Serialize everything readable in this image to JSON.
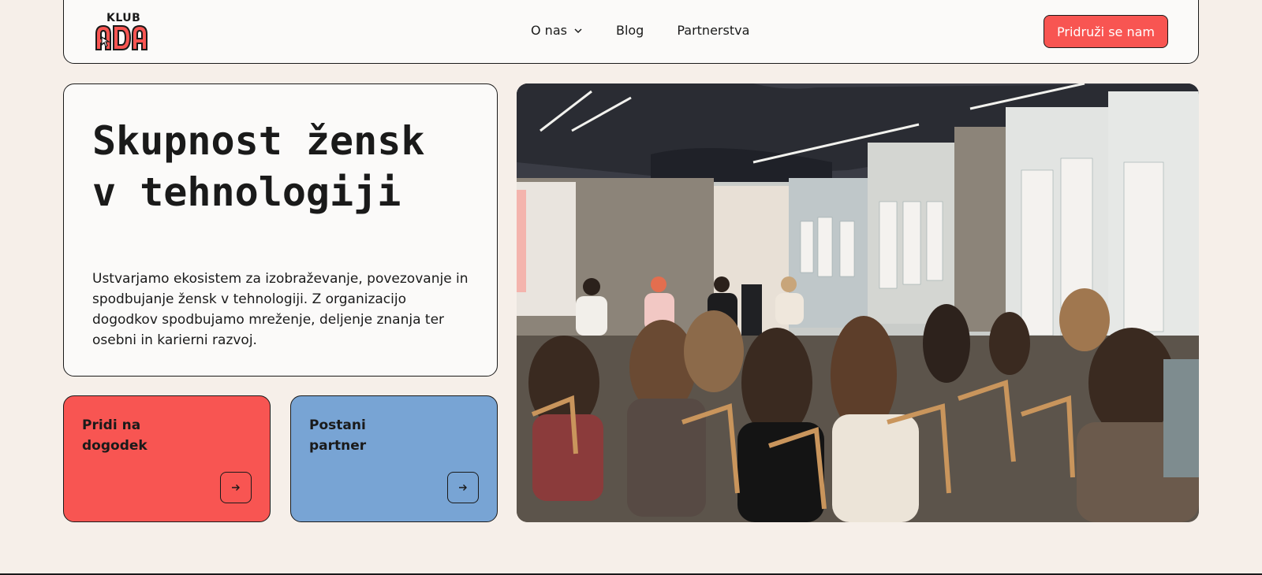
{
  "logo": {
    "text": "KLUB",
    "wordmark": "ADA",
    "brand_red": "#f85552"
  },
  "nav": {
    "items": [
      {
        "label": "O nas",
        "has_dropdown": true
      },
      {
        "label": "Blog",
        "has_dropdown": false
      },
      {
        "label": "Partnerstva",
        "has_dropdown": false
      }
    ],
    "cta_label": "Pridruži se nam"
  },
  "hero": {
    "title_line1": "Skupnost žensk",
    "title_line2": "v tehnologiji",
    "description": "Ustvarjamo ekosistem za izobraževanje, povezovanje in spodbujanje žensk v tehnologiji. Z organizacijo dogodkov spodbujamo mreženje, deljenje znanja ter osebni in karierni razvoj."
  },
  "actions": [
    {
      "label_line1": "Pridi na",
      "label_line2": "dogodek",
      "color": "#f85552",
      "icon": "arrow-right-icon"
    },
    {
      "label_line1": "Postani",
      "label_line2": "partner",
      "color": "#78a4d4",
      "icon": "arrow-right-icon"
    }
  ],
  "colors": {
    "background": "#f6efe9",
    "card": "#fbfaf9",
    "accent_red": "#f85552",
    "accent_blue": "#78a4d4"
  }
}
